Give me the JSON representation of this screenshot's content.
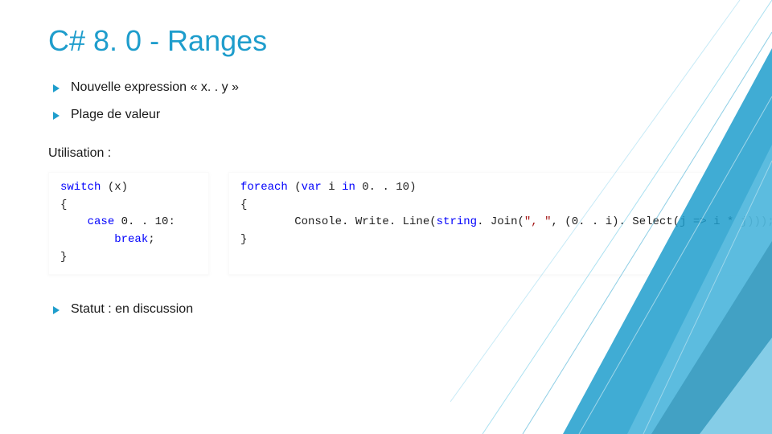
{
  "title": "C# 8. 0 - Ranges",
  "bullets": {
    "b1": "Nouvelle expression « x. . y »",
    "b2": "Plage de valeur"
  },
  "subhead": "Utilisation :",
  "code": {
    "left": {
      "l1_kw": "switch",
      "l1_rest": " (x)",
      "l2": "{",
      "l3_kw": "case",
      "l3_num": " 0. . 10",
      "l3_colon": ":",
      "l4_kw": "break",
      "l4_semi": ";",
      "l5": "}"
    },
    "right": {
      "l1_kw": "foreach",
      "l1_rest_a": " (",
      "l1_var": "var",
      "l1_rest_b": " i ",
      "l1_in": "in",
      "l1_rest_c": " 0. . 10)",
      "l2": "{",
      "l3_indent": "        Console. Write. Line(",
      "l3_string": "string",
      "l3_join": ". Join(",
      "l3_lit": "\", \"",
      "l3_mid": ", (0. . i). Select(j => i * j)));",
      "l4": "}"
    }
  },
  "status": "Statut : en discussion",
  "colors": {
    "accent": "#1e9dcc"
  }
}
